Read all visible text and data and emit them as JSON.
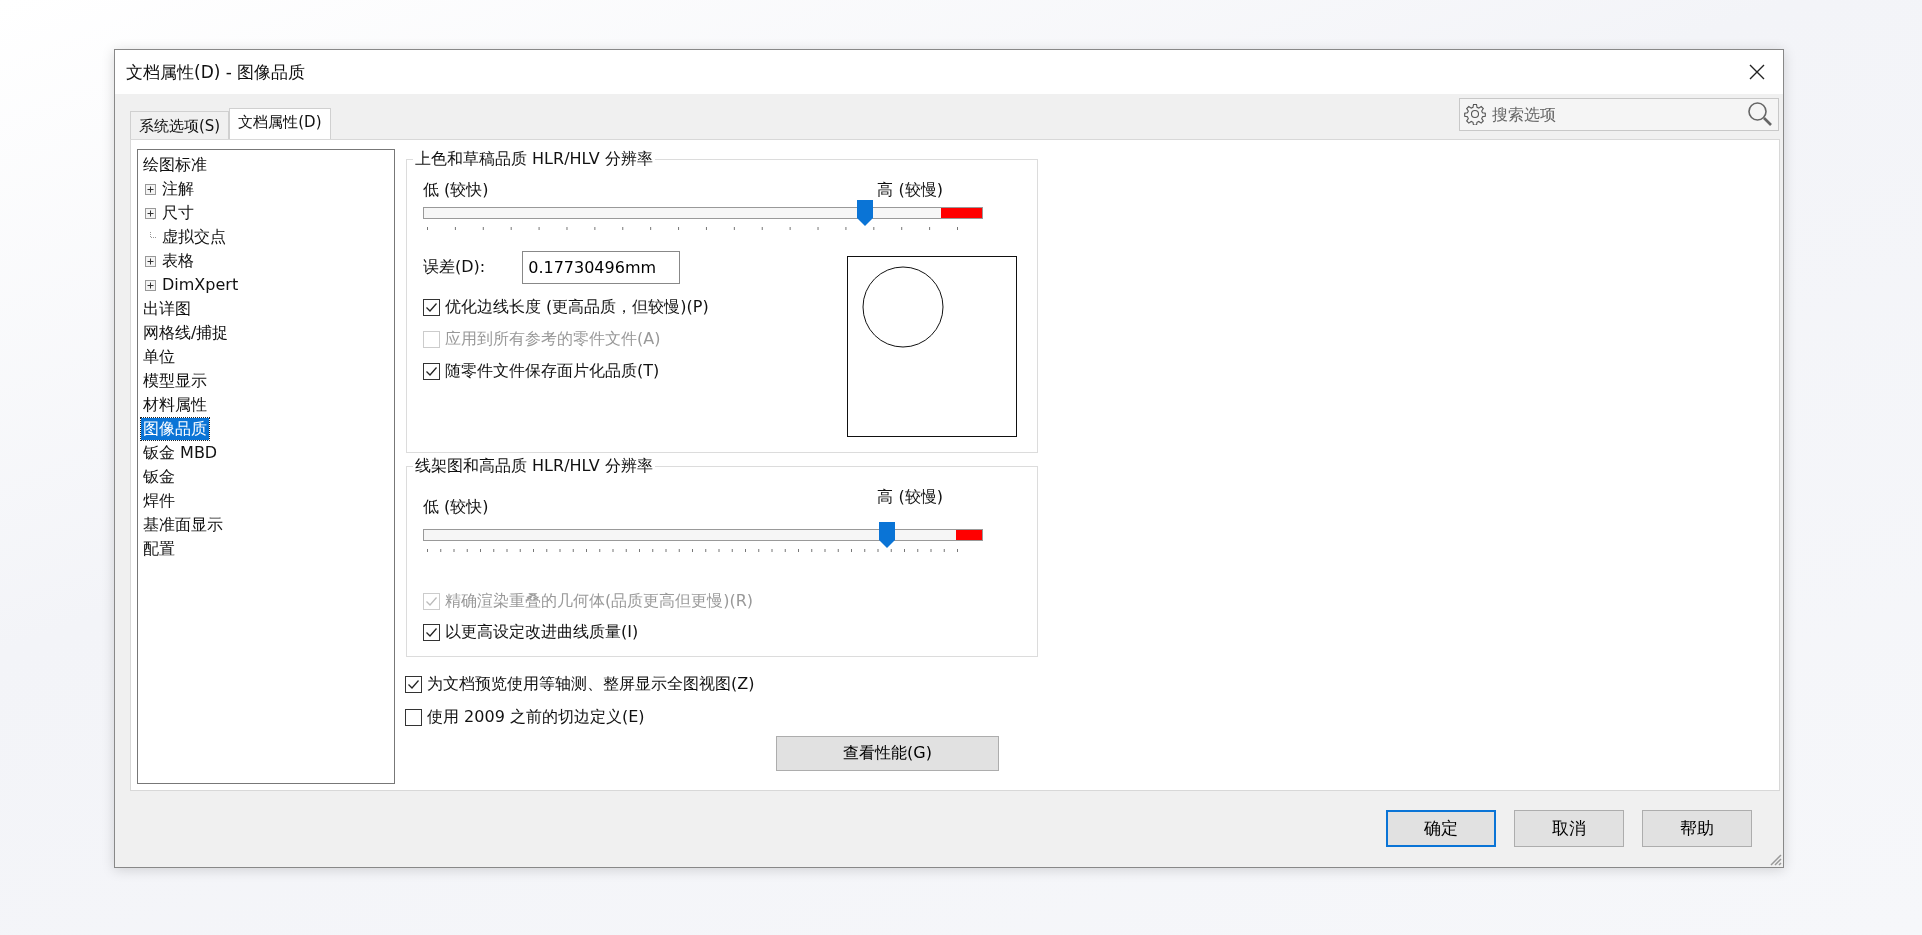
{
  "window": {
    "title": "文档属性(D) - 图像品质"
  },
  "tabs": [
    {
      "label": "系统选项(S)",
      "selected": false
    },
    {
      "label": "文档属性(D)",
      "selected": true
    }
  ],
  "search": {
    "placeholder": "搜索选项"
  },
  "tree": [
    {
      "label": "绘图标准",
      "selected": false,
      "children": [
        {
          "label": "注解",
          "selected": false,
          "expandable": true
        },
        {
          "label": "尺寸",
          "selected": false,
          "expandable": true
        },
        {
          "label": "虚拟交点",
          "selected": false,
          "expandable": false
        },
        {
          "label": "表格",
          "selected": false,
          "expandable": true
        },
        {
          "label": "DimXpert",
          "selected": false,
          "expandable": true
        }
      ]
    },
    {
      "label": "出详图",
      "selected": false
    },
    {
      "label": "网格线/捕捉",
      "selected": false
    },
    {
      "label": "单位",
      "selected": false
    },
    {
      "label": "模型显示",
      "selected": false
    },
    {
      "label": "材料属性",
      "selected": false
    },
    {
      "label": "图像品质",
      "selected": true
    },
    {
      "label": "钣金 MBD",
      "selected": false
    },
    {
      "label": "钣金",
      "selected": false
    },
    {
      "label": "焊件",
      "selected": false
    },
    {
      "label": "基准面显示",
      "selected": false
    },
    {
      "label": "配置",
      "selected": false
    }
  ],
  "groups": [
    {
      "title": "上色和草稿品质 HLR/HLV 分辨率",
      "slider": {
        "low_label": "低 (较快)",
        "high_label": "高 (较慢)",
        "level": 0.79
      },
      "deviation": {
        "label": "误差(D):",
        "value": "0.17730496mm"
      },
      "options": [
        {
          "label": "优化边线长度 (更高品质，但较慢)(P)",
          "checked": true,
          "disabled": false
        },
        {
          "label": "应用到所有参考的零件文件(A)",
          "checked": false,
          "disabled": true
        },
        {
          "label": "随零件文件保存面片化品质(T)",
          "checked": true,
          "disabled": false
        }
      ]
    },
    {
      "title": "线架图和高品质 HLR/HLV 分辨率",
      "slider": {
        "low_label": "低 (较快)",
        "high_label": "高 (较慢)",
        "level": 0.83
      },
      "options": [
        {
          "label": "精确渲染重叠的几何体(品质更高但更慢)(R)",
          "checked": true,
          "disabled": true
        },
        {
          "label": "以更高设定改进曲线质量(I)",
          "checked": true,
          "disabled": false
        }
      ]
    }
  ],
  "options": [
    {
      "label": "为文档预览使用等轴测、整屏显示全图视图(Z)",
      "checked": true,
      "disabled": false
    },
    {
      "label": "使用 2009 之前的切边定义(E)",
      "checked": false,
      "disabled": false
    }
  ],
  "performance_button": "查看性能(G)",
  "buttons": [
    {
      "label": "确定",
      "default": true
    },
    {
      "label": "取消",
      "default": false
    },
    {
      "label": "帮助",
      "default": false
    }
  ]
}
